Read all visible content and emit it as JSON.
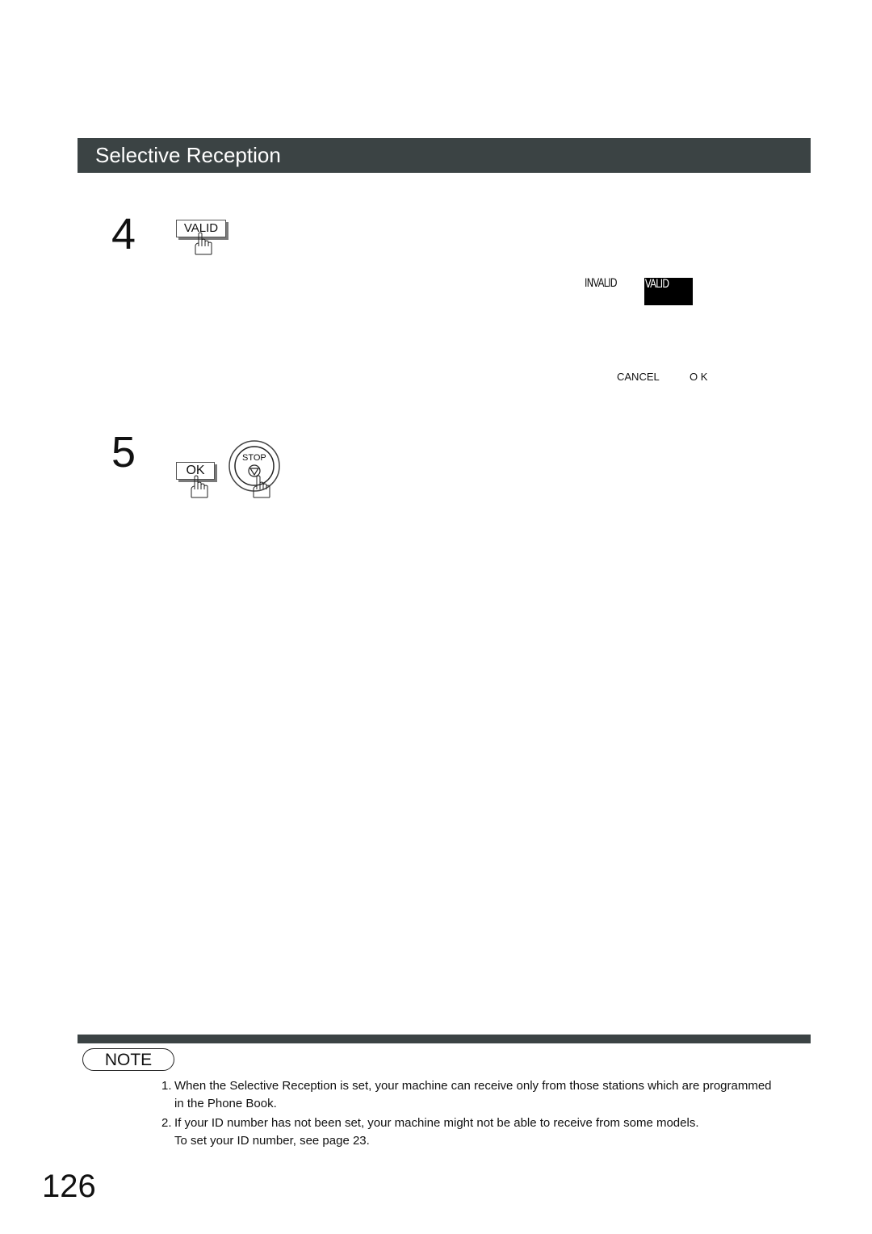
{
  "header": {
    "title": "Selective Reception"
  },
  "steps": [
    {
      "number": "4",
      "keys": [
        {
          "label": "VALID",
          "icon": "pressing-hand-icon"
        }
      ]
    },
    {
      "number": "5",
      "keys": [
        {
          "label": "OK",
          "icon": "pressing-hand-icon"
        },
        {
          "label": "STOP",
          "icon": "stop-triangle-icon"
        }
      ]
    }
  ],
  "display": {
    "options": [
      "INVALID",
      "VALID"
    ],
    "selected": "VALID",
    "soft_keys": [
      "CANCEL",
      "O K"
    ]
  },
  "note": {
    "label": "NOTE",
    "items": [
      {
        "num": "1.",
        "lines": [
          "When the Selective Reception is set, your machine can receive only from those stations which are programmed",
          "in the Phone Book."
        ]
      },
      {
        "num": "2.",
        "lines": [
          "If your ID number has not been set, your machine might not be able to receive from some models.",
          "To set  your ID number, see page 23."
        ]
      }
    ]
  },
  "page_number": "126",
  "colors": {
    "header_bg": "#3b4344",
    "header_text": "#ffffff"
  }
}
